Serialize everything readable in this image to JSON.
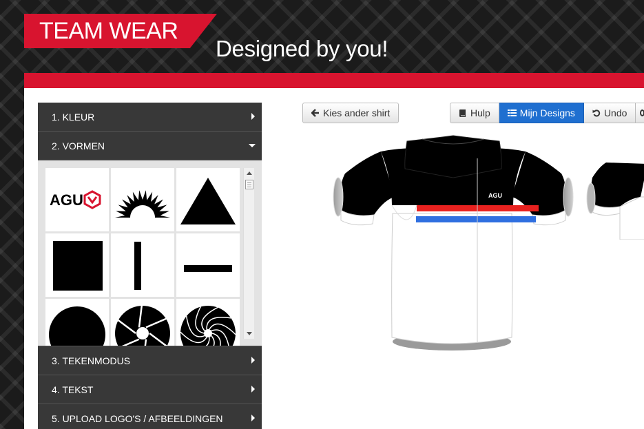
{
  "header": {
    "brand": "TEAM WEAR",
    "tagline": "Designed by you!"
  },
  "sidebar": {
    "sections": [
      {
        "label": "1. KLEUR",
        "state": "collapsed"
      },
      {
        "label": "2. VORMEN",
        "state": "expanded"
      },
      {
        "label": "3. TEKENMODUS",
        "state": "collapsed"
      },
      {
        "label": "4. TEKST",
        "state": "collapsed"
      },
      {
        "label": "5. UPLOAD LOGO'S / AFBEELDINGEN",
        "state": "collapsed"
      }
    ],
    "shapes": [
      {
        "name": "agu-logo-shape",
        "logo_text": "AGU"
      },
      {
        "name": "sunburst-shape"
      },
      {
        "name": "triangle-shape"
      },
      {
        "name": "square-shape"
      },
      {
        "name": "vertical-bar-shape"
      },
      {
        "name": "horizontal-bar-shape"
      },
      {
        "name": "circle-shape"
      },
      {
        "name": "aperture-shape"
      },
      {
        "name": "swirl-shape"
      }
    ]
  },
  "toolbar": {
    "choose_shirt": "Kies ander shirt",
    "help": "Hulp",
    "my_designs": "Mijn Designs",
    "undo": "Undo"
  },
  "jersey": {
    "logo_text": "AGU",
    "colors": {
      "sleeves_shoulders": "#000000",
      "stripe_top": "#e8211f",
      "stripe_bottom": "#2f6fe0",
      "body": "#ffffff",
      "cuffs": "#ffffff"
    }
  },
  "colors": {
    "brand_red": "#d8142f",
    "accordion_dark": "#383838",
    "active_button": "#1f6fd0"
  }
}
